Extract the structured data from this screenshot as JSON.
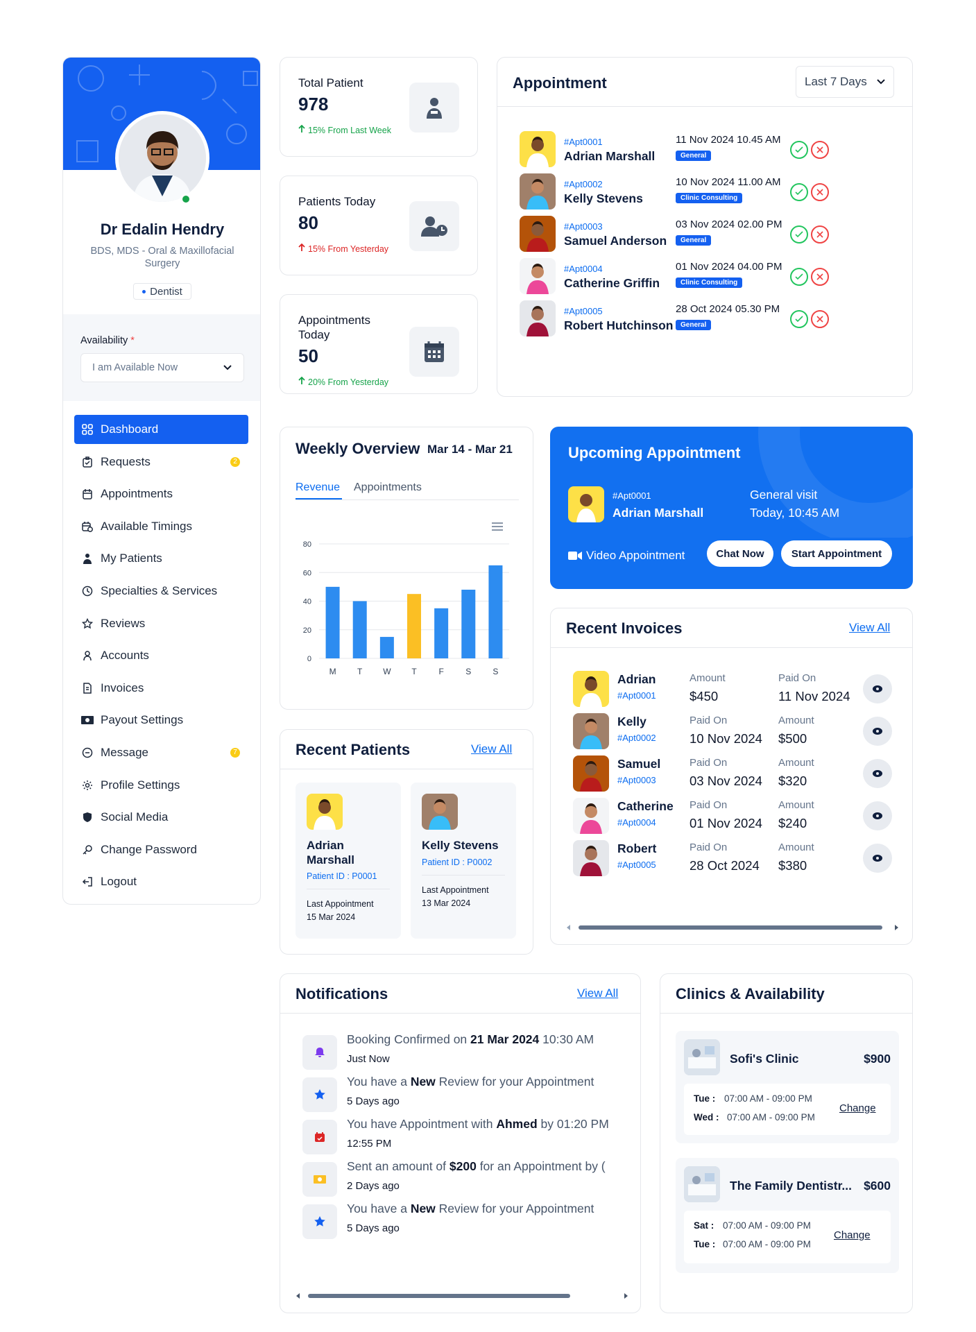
{
  "doctor": {
    "name": "Dr Edalin Hendry",
    "qualification": "BDS, MDS - Oral & Maxillofacial Surgery",
    "specialty": "Dentist",
    "availability_label": "Availability",
    "availability_required": "*",
    "availability_value": "I am Available Now"
  },
  "sidebar": {
    "items": [
      {
        "label": "Dashboard",
        "icon": "grid-icon"
      },
      {
        "label": "Requests",
        "icon": "clipboard-icon",
        "badge": "2"
      },
      {
        "label": "Appointments",
        "icon": "calendar-icon"
      },
      {
        "label": "Available Timings",
        "icon": "calendar-clock-icon"
      },
      {
        "label": "My Patients",
        "icon": "patient-icon"
      },
      {
        "label": "Specialties & Services",
        "icon": "clock-icon"
      },
      {
        "label": "Reviews",
        "icon": "star-icon"
      },
      {
        "label": "Accounts",
        "icon": "user-icon"
      },
      {
        "label": "Invoices",
        "icon": "invoice-icon"
      },
      {
        "label": "Payout Settings",
        "icon": "money-icon"
      },
      {
        "label": "Message",
        "icon": "chat-icon",
        "badge": "7"
      },
      {
        "label": "Profile Settings",
        "icon": "settings-icon"
      },
      {
        "label": "Social Media",
        "icon": "shield-icon"
      },
      {
        "label": "Change Password",
        "icon": "key-icon"
      },
      {
        "label": "Logout",
        "icon": "logout-icon"
      }
    ]
  },
  "stats": [
    {
      "label": "Total Patient",
      "value": "978",
      "change": "15% From Last Week",
      "direction": "up",
      "color": "#16a34a"
    },
    {
      "label": "Patients Today",
      "value": "80",
      "change": "15% From Yesterday",
      "direction": "up",
      "color": "#dc2626"
    },
    {
      "label": "Appointments Today",
      "value": "50",
      "change": "20% From Yesterday",
      "direction": "up",
      "color": "#16a34a"
    }
  ],
  "appointments": {
    "title": "Appointment",
    "filter": "Last 7 Days",
    "rows": [
      {
        "id": "#Apt0001",
        "name": "Adrian Marshall",
        "date": "11 Nov 2024 10.45 AM",
        "type": "General"
      },
      {
        "id": "#Apt0002",
        "name": "Kelly Stevens",
        "date": "10 Nov 2024 11.00 AM",
        "type": "Clinic Consulting"
      },
      {
        "id": "#Apt0003",
        "name": "Samuel Anderson",
        "date": "03 Nov 2024 02.00 PM",
        "type": "General"
      },
      {
        "id": "#Apt0004",
        "name": "Catherine Griffin",
        "date": "01 Nov 2024 04.00 PM",
        "type": "Clinic Consulting"
      },
      {
        "id": "#Apt0005",
        "name": "Robert Hutchinson",
        "date": "28 Oct 2024 05.30 PM",
        "type": "General"
      }
    ]
  },
  "weekly": {
    "title": "Weekly Overview",
    "range": "Mar 14 - Mar 21",
    "tabs": [
      "Revenue",
      "Appointments"
    ],
    "active_tab": "Revenue"
  },
  "chart_data": {
    "type": "bar",
    "categories": [
      "M",
      "T",
      "W",
      "T",
      "F",
      "S",
      "S"
    ],
    "values": [
      50,
      40,
      15,
      45,
      35,
      48,
      65
    ],
    "highlight_index": 3,
    "bar_color": "#2d8cf0",
    "highlight_color": "#fbbf24",
    "yticks": [
      0,
      20,
      40,
      60,
      80
    ],
    "ylim": [
      0,
      80
    ]
  },
  "upcoming": {
    "title": "Upcoming Appointment",
    "id": "#Apt0001",
    "name": "Adrian Marshall",
    "visit_type": "General visit",
    "time": "Today, 10:45 AM",
    "video_label": "Video Appointment",
    "chat_btn": "Chat Now",
    "start_btn": "Start Appointment"
  },
  "invoices": {
    "title": "Recent Invoices",
    "view_all": "View All",
    "rows": [
      {
        "name": "Adrian",
        "id": "#Apt0001",
        "l1": "Amount",
        "v1": "$450",
        "l2": "Paid On",
        "v2": "11 Nov 2024"
      },
      {
        "name": "Kelly",
        "id": "#Apt0002",
        "l1": "Paid On",
        "v1": "10 Nov 2024",
        "l2": "Amount",
        "v2": "$500"
      },
      {
        "name": "Samuel",
        "id": "#Apt0003",
        "l1": "Paid On",
        "v1": "03 Nov 2024",
        "l2": "Amount",
        "v2": "$320"
      },
      {
        "name": "Catherine",
        "id": "#Apt0004",
        "l1": "Paid On",
        "v1": "01 Nov 2024",
        "l2": "Amount",
        "v2": "$240"
      },
      {
        "name": "Robert",
        "id": "#Apt0005",
        "l1": "Paid On",
        "v1": "28 Oct 2024",
        "l2": "Amount",
        "v2": "$380"
      }
    ]
  },
  "recent_patients": {
    "title": "Recent Patients",
    "view_all": "View All",
    "cards": [
      {
        "name": "Adrian Marshall",
        "pid": "Patient ID : P0001",
        "last_label": "Last Appointment",
        "last_date": "15 Mar 2024"
      },
      {
        "name": "Kelly Stevens",
        "pid": "Patient ID : P0002",
        "last_label": "Last Appointment",
        "last_date": "13 Mar 2024"
      }
    ]
  },
  "notifications": {
    "title": "Notifications",
    "view_all": "View All",
    "items": [
      {
        "pre": "Booking Confirmed on ",
        "bold": "21 Mar 2024",
        "post": " 10:30 AM",
        "time": "Just Now",
        "icon": "bell-icon",
        "color": "#7c3aed"
      },
      {
        "pre": "You have a ",
        "bold": "New",
        "post": " Review for your Appointment",
        "time": "5 Days ago",
        "icon": "star-icon",
        "color": "#1460f0"
      },
      {
        "pre": "You have Appointment with ",
        "bold": "Ahmed",
        "post": " by 01:20 PM",
        "time": "12:55 PM",
        "icon": "calendar-icon",
        "color": "#dc2626"
      },
      {
        "pre": "Sent an amount of ",
        "bold": "$200",
        "post": " for an Appointment by (",
        "time": "2 Days ago",
        "icon": "money-icon",
        "color": "#fbbf24"
      },
      {
        "pre": "You have a ",
        "bold": "New",
        "post": " Review for your Appointment",
        "time": "5 Days ago",
        "icon": "star-icon",
        "color": "#1460f0"
      }
    ]
  },
  "clinics": {
    "title": "Clinics & Availability",
    "items": [
      {
        "name": "Sofi's Clinic",
        "price": "$900",
        "d1": "Tue :",
        "t1": "07:00 AM - 09:00 PM",
        "d2": "Wed :",
        "t2": "07:00 AM - 09:00 PM",
        "action": "Change"
      },
      {
        "name": "The Family Dentistr...",
        "price": "$600",
        "d1": "Sat :",
        "t1": "07:00 AM - 09:00 PM",
        "d2": "Tue :",
        "t2": "07:00 AM - 09:00 PM",
        "action": "Change"
      }
    ]
  }
}
